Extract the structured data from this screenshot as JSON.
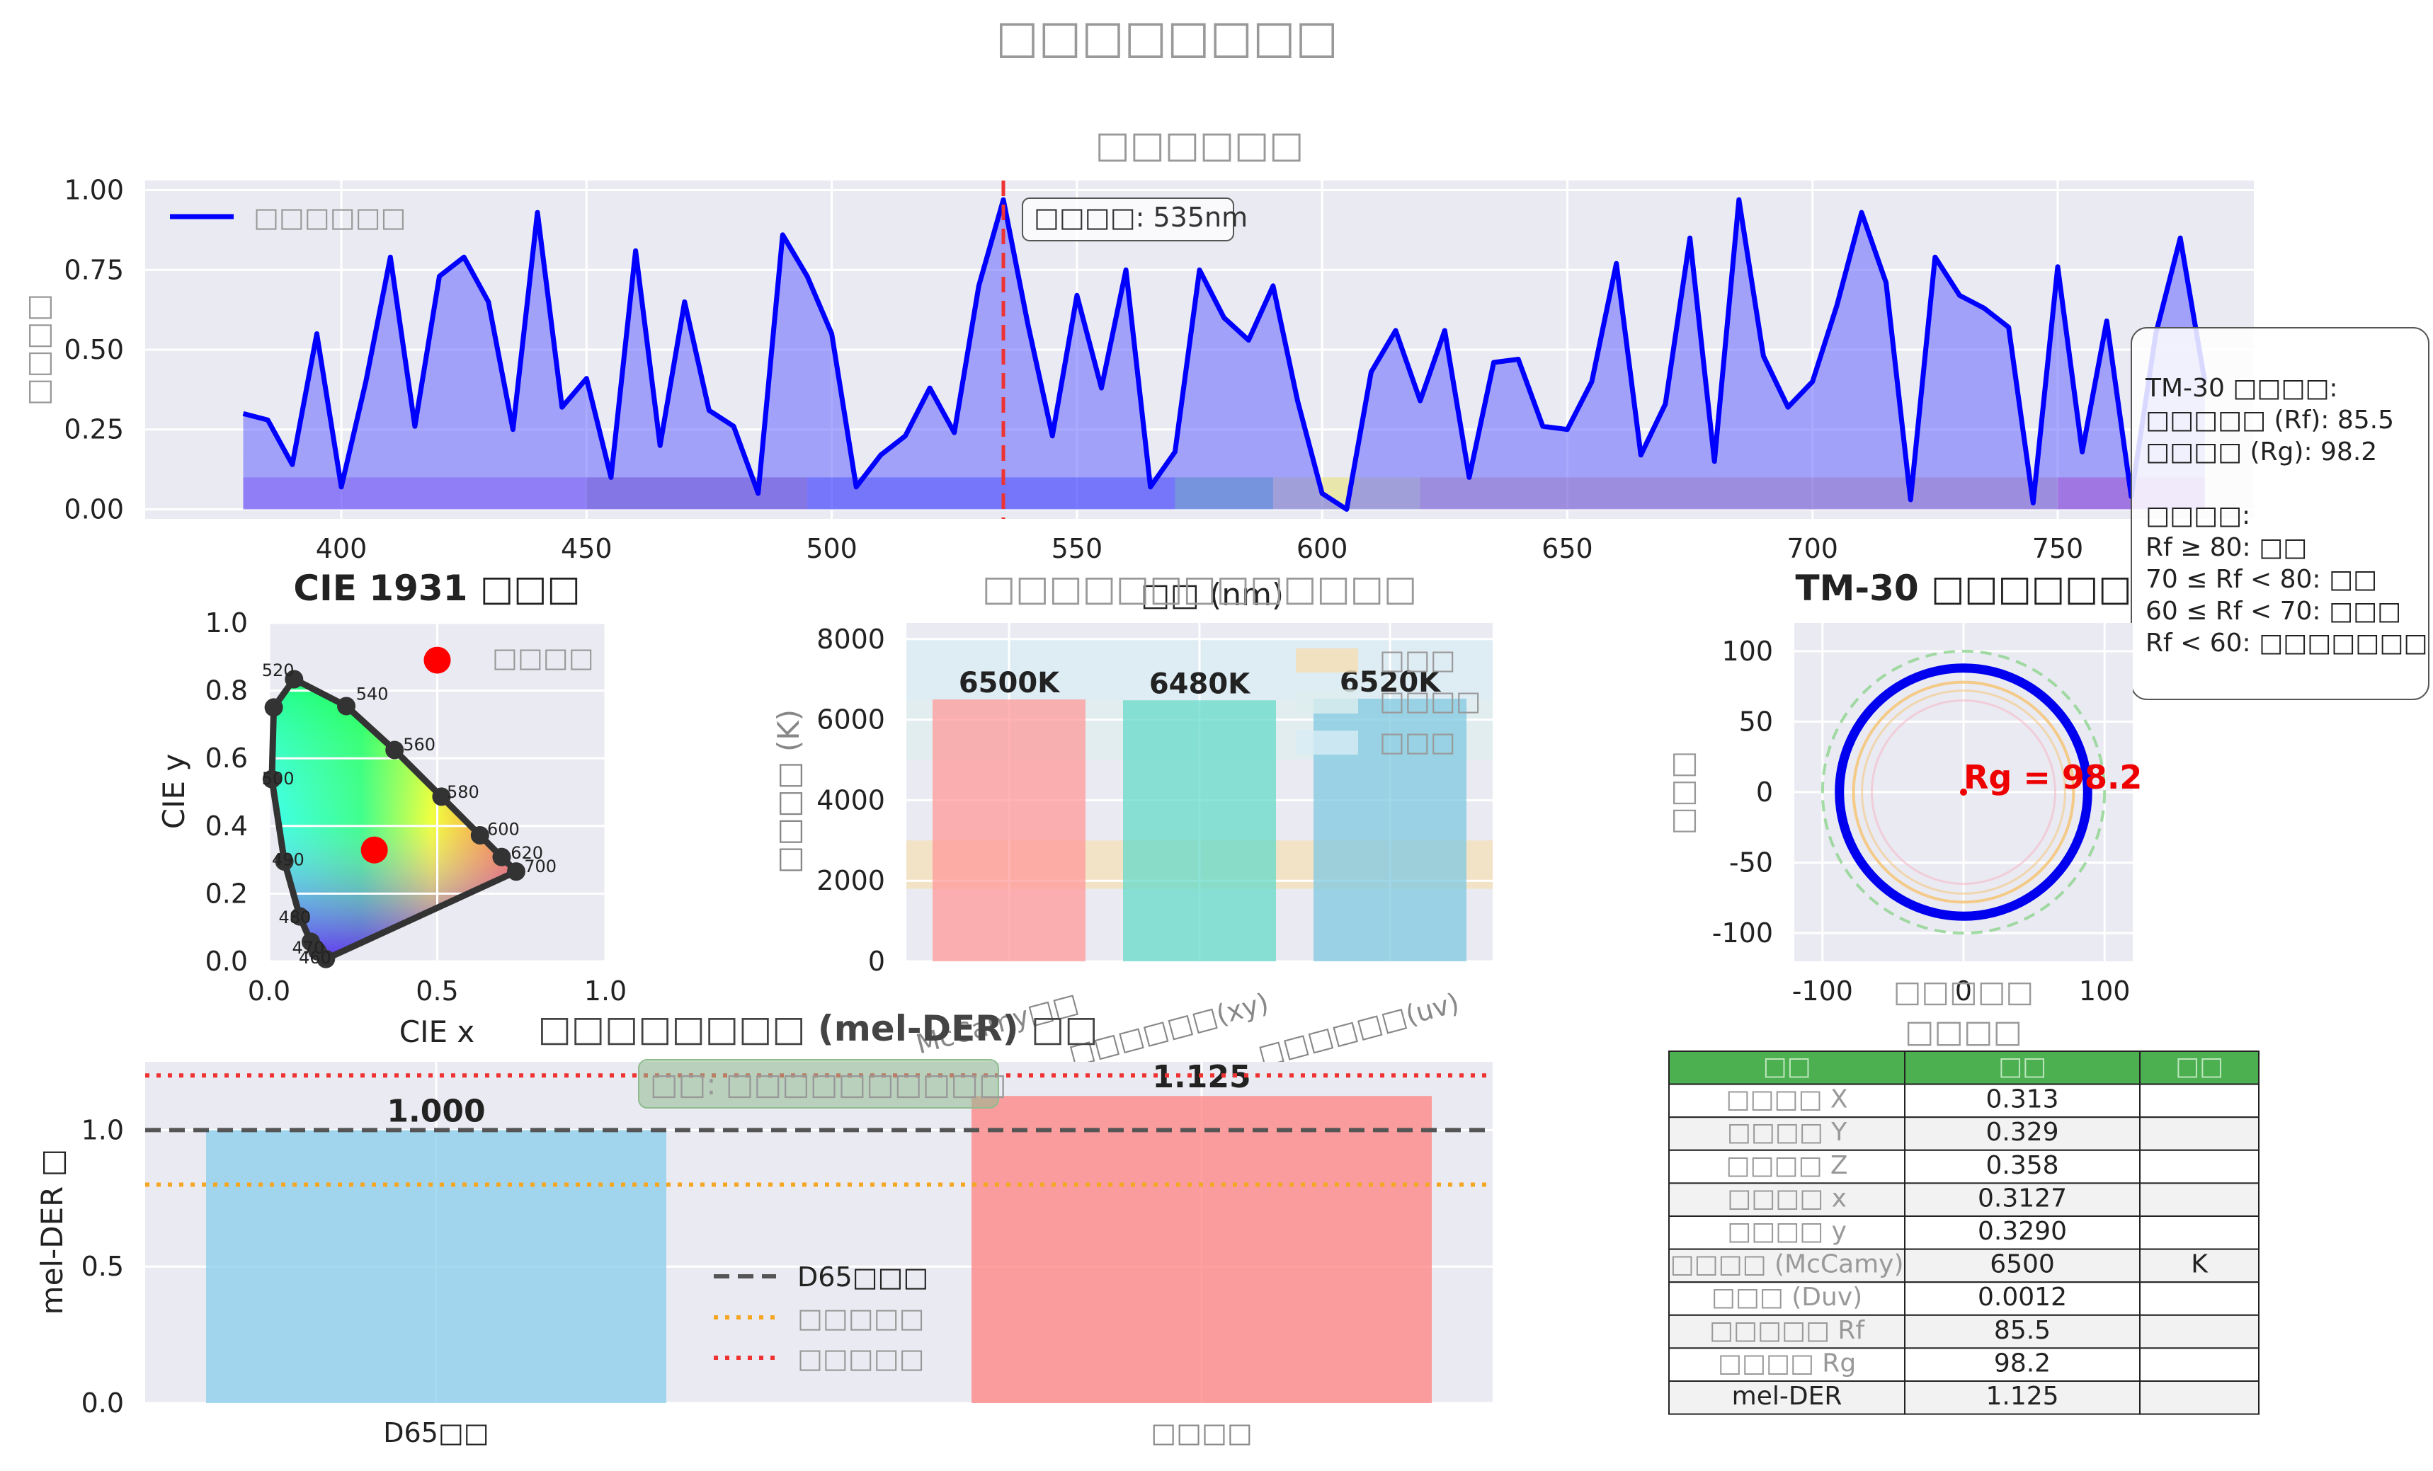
{
  "figure": {
    "suptitle": "□□□□□□□□"
  },
  "spectrum": {
    "title": "□□□□□□",
    "ylabel": "□□□□",
    "xlabel": "□□ (nm)",
    "legend": "□□□□□□",
    "peak_label": "□□□□: 535nm",
    "xticks": [
      "400",
      "450",
      "500",
      "550",
      "600",
      "650",
      "700",
      "750"
    ],
    "yticks": [
      "0.00",
      "0.25",
      "0.50",
      "0.75",
      "1.00"
    ],
    "band_colors": [
      "#8a2be2",
      "#4b0082",
      "#0000ff",
      "#00a060",
      "#e8e040",
      "#d98060",
      "#e00070"
    ]
  },
  "tm30_box": {
    "lines": [
      "TM-30 □□□□:",
      "□□□□□ (Rf): 85.5",
      "□□□□ (Rg): 98.2",
      "",
      "□□□□:",
      "Rf ≥ 80: □□",
      "70 ≤ Rf < 80: □□",
      "60 ≤ Rf < 70: □□□",
      "Rf < 60: □□□□□□□"
    ]
  },
  "cie": {
    "title": "CIE 1931 □□□",
    "xlabel": "CIE x",
    "ylabel": "CIE y",
    "legend": "□□□□",
    "xticks": [
      "0.0",
      "0.5",
      "1.0"
    ],
    "yticks": [
      "0.0",
      "0.2",
      "0.4",
      "0.6",
      "0.8",
      "1.0"
    ],
    "wavelength_labels": [
      "460",
      "470",
      "480",
      "490",
      "500",
      "520",
      "540",
      "560",
      "580",
      "600",
      "620",
      "700"
    ]
  },
  "cct": {
    "title": "□□□□□□□□□□□□□",
    "ylabel": "□□□□ (K)",
    "yticks": [
      "0",
      "2000",
      "4000",
      "6000",
      "8000"
    ],
    "xticklabels": [
      "McCamy□□",
      "□□□□□□(xy)",
      "□□□□□□(uv)"
    ],
    "bar_labels": [
      "6500K",
      "6480K",
      "6520K"
    ],
    "legend": [
      "□□□",
      "□□□□",
      "□□□"
    ]
  },
  "tm30": {
    "title": "TM-30 □□□□□□",
    "ylabel": "□□□",
    "xlabel": "□□□□□",
    "rg_label": "Rg = 98.2",
    "xticks": [
      "-100",
      "0",
      "100"
    ],
    "yticks": [
      "100",
      "50",
      "0",
      "-50",
      "-100"
    ]
  },
  "mel": {
    "title": "□□□□□□□□ (mel-DER) □□",
    "ylabel": "mel-DER □",
    "yticks": [
      "0.0",
      "0.5",
      "1.0"
    ],
    "xticklabels": [
      "D65□□",
      "□□□□"
    ],
    "bar_labels": [
      "1.000",
      "1.125"
    ],
    "evaluation": "□□: □□□□□□□□□□",
    "legend": [
      "D65□□□",
      "□□□□□",
      "□□□□□"
    ]
  },
  "table": {
    "title": "□□□□",
    "headers": [
      "□□",
      "□□",
      "□□"
    ],
    "rows": [
      [
        "□□□□ X",
        "0.313",
        ""
      ],
      [
        "□□□□ Y",
        "0.329",
        ""
      ],
      [
        "□□□□ Z",
        "0.358",
        ""
      ],
      [
        "□□□□ x",
        "0.3127",
        ""
      ],
      [
        "□□□□ y",
        "0.3290",
        ""
      ],
      [
        "□□□□ (McCamy)",
        "6500",
        "K"
      ],
      [
        "□□□ (Duv)",
        "0.0012",
        ""
      ],
      [
        "□□□□□ Rf",
        "85.5",
        ""
      ],
      [
        "□□□□ Rg",
        "98.2",
        ""
      ],
      [
        "mel-DER",
        "1.125",
        ""
      ]
    ]
  },
  "chart_data": [
    {
      "type": "area",
      "name": "spectrum",
      "x": [
        380,
        385,
        390,
        395,
        400,
        405,
        410,
        415,
        420,
        425,
        430,
        435,
        440,
        445,
        450,
        455,
        460,
        465,
        470,
        475,
        480,
        485,
        490,
        495,
        500,
        505,
        510,
        515,
        520,
        525,
        530,
        535,
        540,
        545,
        550,
        555,
        560,
        565,
        570,
        575,
        580,
        585,
        590,
        595,
        600,
        605,
        610,
        615,
        620,
        625,
        630,
        635,
        640,
        645,
        650,
        655,
        660,
        665,
        670,
        675,
        680,
        685,
        690,
        695,
        700,
        705,
        710,
        715,
        720,
        725,
        730,
        735,
        740,
        745,
        750,
        755,
        760,
        765,
        770,
        775,
        780
      ],
      "y": [
        0.3,
        0.28,
        0.14,
        0.55,
        0.07,
        0.4,
        0.79,
        0.26,
        0.73,
        0.79,
        0.65,
        0.25,
        0.93,
        0.32,
        0.41,
        0.1,
        0.81,
        0.2,
        0.65,
        0.31,
        0.26,
        0.05,
        0.86,
        0.73,
        0.55,
        0.07,
        0.17,
        0.23,
        0.38,
        0.24,
        0.7,
        0.97,
        0.58,
        0.23,
        0.67,
        0.38,
        0.75,
        0.07,
        0.18,
        0.75,
        0.6,
        0.53,
        0.7,
        0.34,
        0.05,
        0.0,
        0.43,
        0.56,
        0.34,
        0.56,
        0.1,
        0.46,
        0.47,
        0.26,
        0.25,
        0.4,
        0.77,
        0.17,
        0.33,
        0.85,
        0.15,
        0.97,
        0.48,
        0.32,
        0.4,
        0.64,
        0.93,
        0.71,
        0.03,
        0.79,
        0.67,
        0.63,
        0.57,
        0.02,
        0.76,
        0.18,
        0.59,
        0.04,
        0.55,
        0.85,
        0.4
      ],
      "xlim": [
        360,
        790
      ],
      "ylim": [
        -0.03,
        1.03
      ],
      "peak_wavelength": 535,
      "bands": [
        [
          380,
          450
        ],
        [
          450,
          495
        ],
        [
          495,
          570
        ],
        [
          570,
          590
        ],
        [
          590,
          620
        ],
        [
          620,
          750
        ],
        [
          750,
          780
        ]
      ]
    },
    {
      "type": "scatter",
      "name": "cie1931",
      "locus_x": [
        0.1689,
        0.144,
        0.1241,
        0.0913,
        0.0454,
        0.0082,
        0.0139,
        0.0743,
        0.2296,
        0.3731,
        0.5125,
        0.627,
        0.6915,
        0.7347
      ],
      "locus_y": [
        0.0069,
        0.0297,
        0.0578,
        0.1327,
        0.295,
        0.5384,
        0.7502,
        0.8338,
        0.7543,
        0.6245,
        0.4866,
        0.3725,
        0.3083,
        0.2653
      ],
      "point": [
        0.313,
        0.329
      ],
      "legend_point": [
        0.5,
        0.89
      ],
      "xlim": [
        0,
        1
      ],
      "ylim": [
        0,
        1
      ]
    },
    {
      "type": "bar",
      "name": "cct",
      "categories": [
        "McCamy□□",
        "□□□□□□(xy)",
        "□□□□□□(uv)"
      ],
      "values": [
        6500,
        6480,
        6520
      ],
      "colors": [
        "#ff9999",
        "#66d9c8",
        "#7fc8e0"
      ],
      "ylim": [
        0,
        8400
      ],
      "bands": [
        [
          1800,
          3000
        ],
        [
          5000,
          6500
        ],
        [
          6500,
          8000
        ]
      ],
      "band_colors": [
        "#f5deb3",
        "#ddeeee",
        "#d8ecf5"
      ]
    },
    {
      "type": "scatter",
      "name": "tm30",
      "rg_radius": 88,
      "rf_radius": 85.5,
      "ref_radius": 100,
      "center": [
        0,
        0
      ],
      "xlim": [
        -120,
        120
      ],
      "ylim": [
        -120,
        120
      ]
    },
    {
      "type": "bar",
      "name": "mel-der",
      "categories": [
        "D65□□",
        "□□□□"
      ],
      "values": [
        1.0,
        1.125
      ],
      "colors": [
        "#87ceeb",
        "#ff8080"
      ],
      "ylim": [
        0,
        1.25
      ],
      "reference_lines": [
        1.0,
        0.8,
        1.2
      ]
    }
  ]
}
